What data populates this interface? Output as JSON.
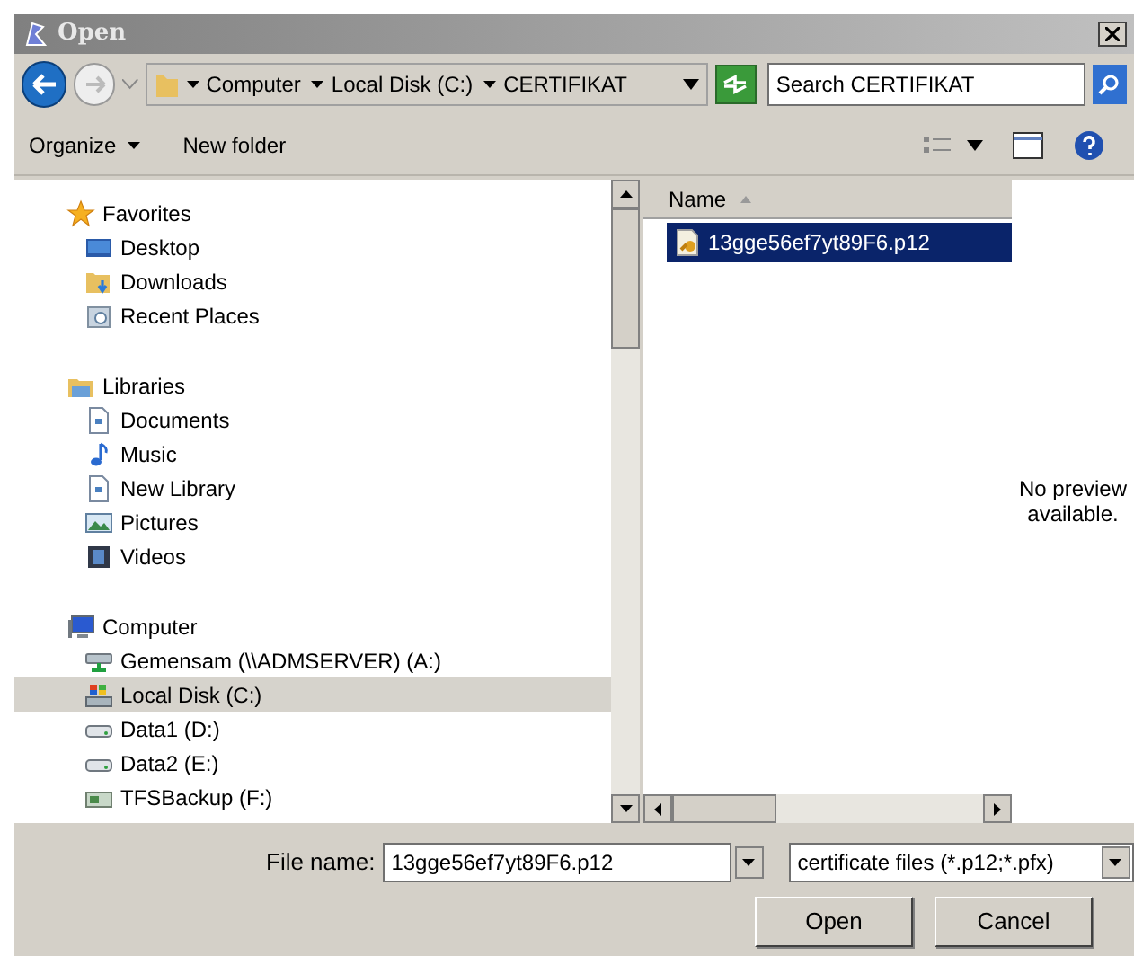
{
  "window": {
    "title": "Open"
  },
  "address_bar": {
    "breadcrumbs": [
      "Computer",
      "Local Disk (C:)",
      "CERTIFIKAT"
    ]
  },
  "search": {
    "placeholder": "Search CERTIFIKAT"
  },
  "toolbar": {
    "items": [
      "Organize",
      "New folder"
    ]
  },
  "navigation": {
    "sections": [
      {
        "label": "Favorites",
        "kind": "star",
        "selected": false,
        "children": [
          {
            "label": "Desktop",
            "kind": "desktop",
            "selected": false
          },
          {
            "label": "Downloads",
            "kind": "downloads",
            "selected": false
          },
          {
            "label": "Recent Places",
            "kind": "recent",
            "selected": false
          }
        ]
      },
      {
        "label": "Libraries",
        "kind": "library",
        "selected": false,
        "children": [
          {
            "label": "Documents",
            "kind": "document",
            "selected": false
          },
          {
            "label": "Music",
            "kind": "music",
            "selected": false
          },
          {
            "label": "New Library",
            "kind": "document",
            "selected": false
          },
          {
            "label": "Pictures",
            "kind": "picture",
            "selected": false
          },
          {
            "label": "Videos",
            "kind": "video",
            "selected": false
          }
        ]
      },
      {
        "label": "Computer",
        "kind": "computer",
        "selected": false,
        "children": [
          {
            "label": "Gemensam (\\\\ADMSERVER) (A:)",
            "kind": "network",
            "selected": false
          },
          {
            "label": "Local Disk (C:)",
            "kind": "system",
            "selected": true
          },
          {
            "label": "Data1 (D:)",
            "kind": "drive",
            "selected": false
          },
          {
            "label": "Data2 (E:)",
            "kind": "drive",
            "selected": false
          },
          {
            "label": "TFSBackup (F:)",
            "kind": "backup",
            "selected": false
          }
        ]
      }
    ]
  },
  "file_list": {
    "columns": [
      "Name"
    ],
    "rows": [
      {
        "name": "13gge56ef7yt89F6.p12",
        "selected": true
      }
    ]
  },
  "preview": {
    "message": "No preview available."
  },
  "file_name": {
    "label": "File name:",
    "value": "13gge56ef7yt89F6.p12"
  },
  "file_type": {
    "value": "certificate files (*.p12;*.pfx)"
  },
  "buttons": [
    "Open",
    "Cancel"
  ]
}
